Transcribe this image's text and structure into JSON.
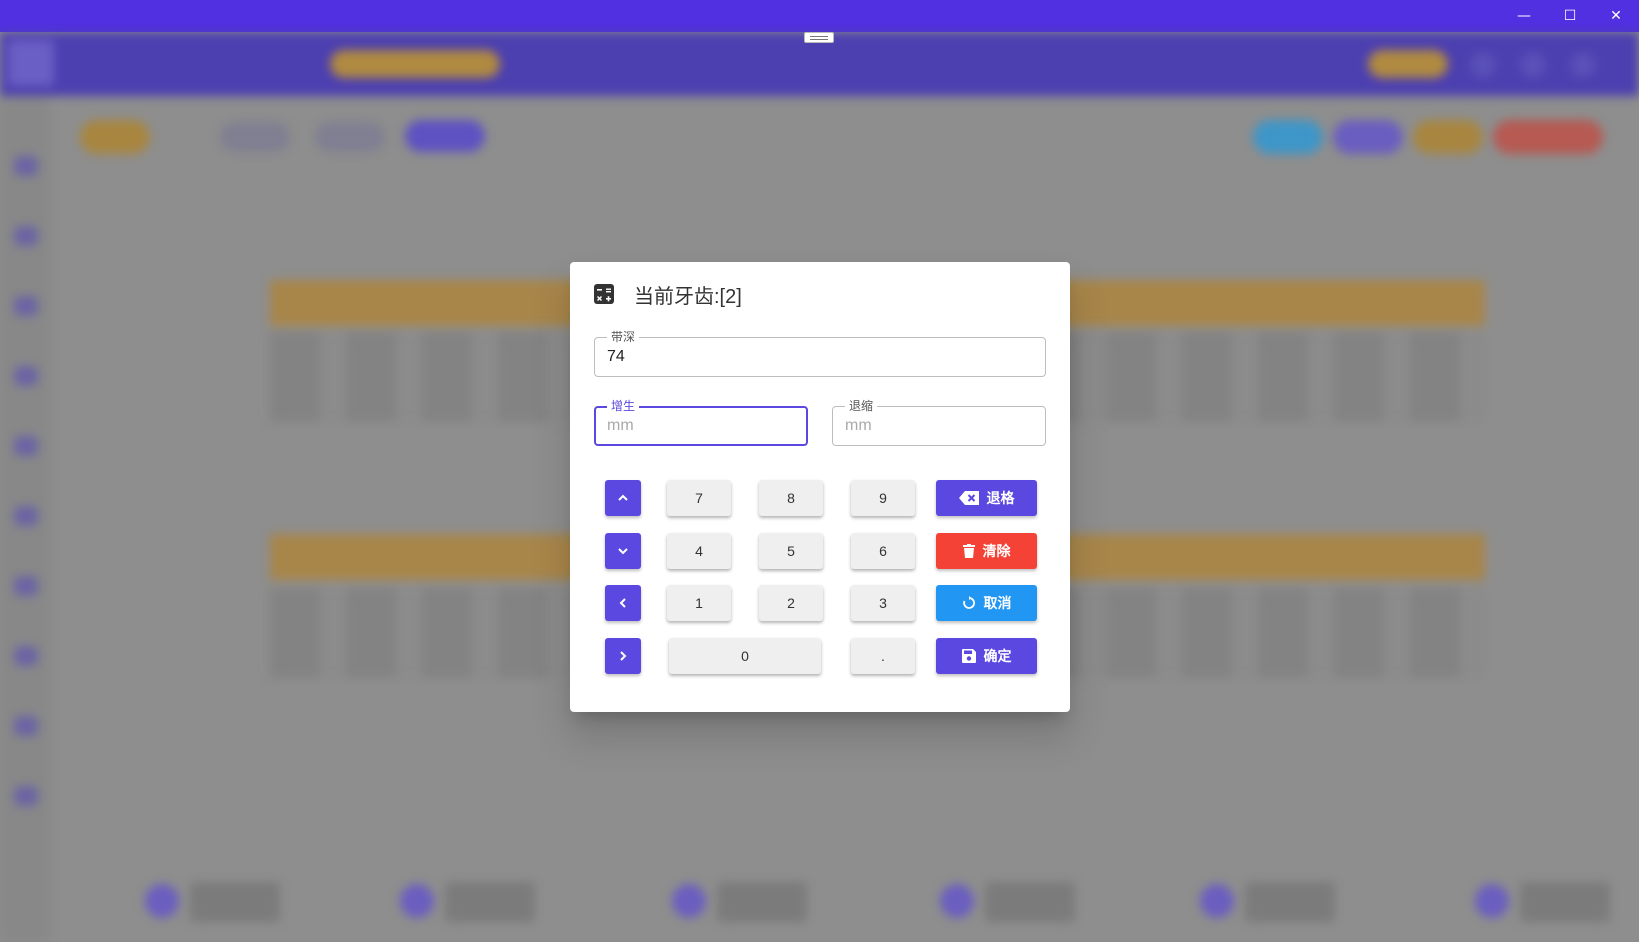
{
  "window": {
    "controls": {
      "minimize": "—",
      "maximize": "☐",
      "close": "✕"
    }
  },
  "dialog": {
    "title": "当前牙齿:[2]",
    "icon": "calculator-icon",
    "fields": {
      "depth": {
        "label": "带深",
        "value": "74",
        "placeholder": ""
      },
      "growth": {
        "label": "增生",
        "value": "",
        "placeholder": "mm"
      },
      "recession": {
        "label": "退缩",
        "value": "",
        "placeholder": "mm"
      }
    },
    "keypad": {
      "k7": "7",
      "k8": "8",
      "k9": "9",
      "k4": "4",
      "k5": "5",
      "k6": "6",
      "k1": "1",
      "k2": "2",
      "k3": "3",
      "k0": "0",
      "dot": "."
    },
    "actions": {
      "backspace": "退格",
      "clear": "清除",
      "cancel": "取消",
      "confirm": "确定"
    },
    "colors": {
      "primary": "#5a48e0",
      "danger": "#f44336",
      "info": "#2196f3",
      "titlebar": "#5130e2"
    }
  }
}
